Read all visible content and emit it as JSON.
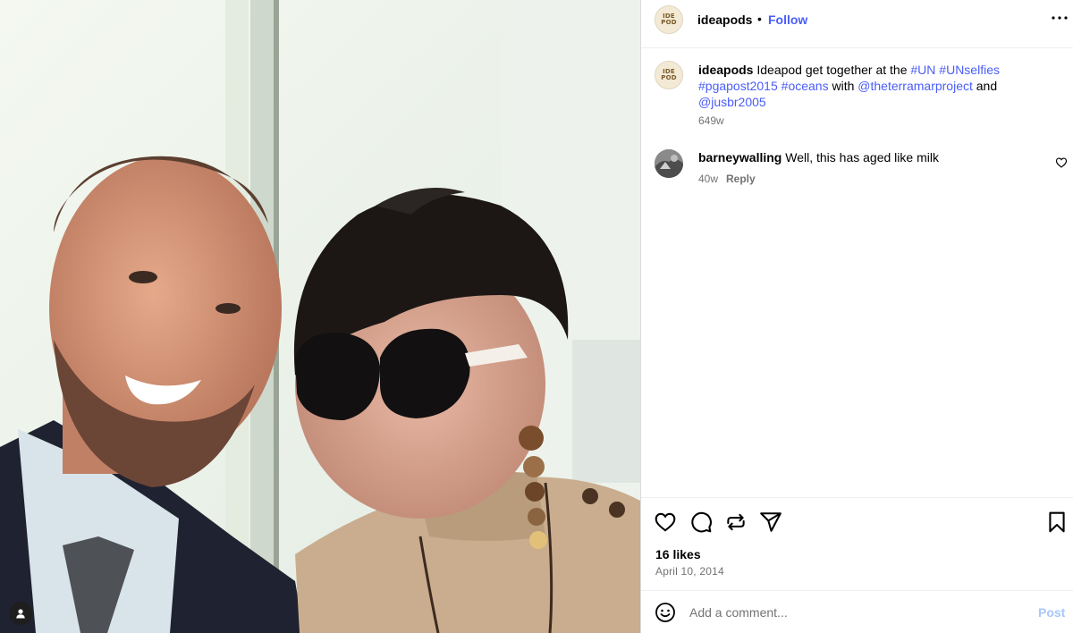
{
  "post": {
    "username": "ideapods",
    "separator": "•",
    "follow_label": "Follow",
    "avatar_text": [
      "IDE",
      "POD"
    ],
    "more_icon": "more-horizontal-icon"
  },
  "caption": {
    "username": "ideapods",
    "text_1": " Ideapod get together at the ",
    "tag_un": "#UN",
    "tag_unselfies": "#UNselfies",
    "tag_pgapost": "#pgapost2015",
    "tag_oceans": "#oceans",
    "text_2": " with ",
    "mention_terramar": "@theterramarproject",
    "text_3": " and",
    "mention_jusbr": "@jusbr2005",
    "time": "649w"
  },
  "comments": [
    {
      "username": "barneywalling",
      "text": " Well, this has aged like milk",
      "time": "40w",
      "reply_label": "Reply"
    }
  ],
  "actions": {
    "icons": [
      "heart-icon",
      "comment-icon",
      "repost-icon",
      "share-icon",
      "bookmark-icon"
    ],
    "likes": "16 likes",
    "date": "April 10, 2014"
  },
  "add_comment": {
    "placeholder": "Add a comment...",
    "post_label": "Post"
  },
  "colors": {
    "link": "#4a5df9",
    "post_disabled": "#a8c7fa",
    "meta": "#737373"
  }
}
